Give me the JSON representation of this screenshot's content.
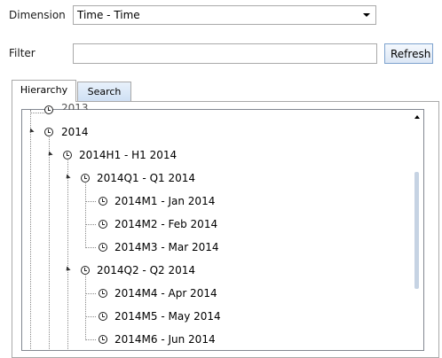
{
  "dimension": {
    "label": "Dimension",
    "value": "Time - Time"
  },
  "filter": {
    "label": "Filter",
    "value": "",
    "placeholder": ""
  },
  "refresh_label": "Refresh",
  "tabs": {
    "hierarchy": "Hierarchy",
    "search": "Search",
    "active": "Hierarchy"
  },
  "tree": {
    "top_partial": "2013",
    "nodes": [
      {
        "text": "2014",
        "expanded": true
      },
      {
        "text": "2014H1 - H1 2014",
        "expanded": true
      },
      {
        "text": "2014Q1 - Q1 2014",
        "expanded": true
      },
      {
        "text": "2014M1 - Jan 2014"
      },
      {
        "text": "2014M2 - Feb 2014"
      },
      {
        "text": "2014M3 - Mar 2014"
      },
      {
        "text": "2014Q2 - Q2 2014",
        "expanded": true
      },
      {
        "text": "2014M4 - Apr 2014"
      },
      {
        "text": "2014M5 - May 2014"
      },
      {
        "text": "2014M6 - Jun 2014"
      }
    ]
  }
}
